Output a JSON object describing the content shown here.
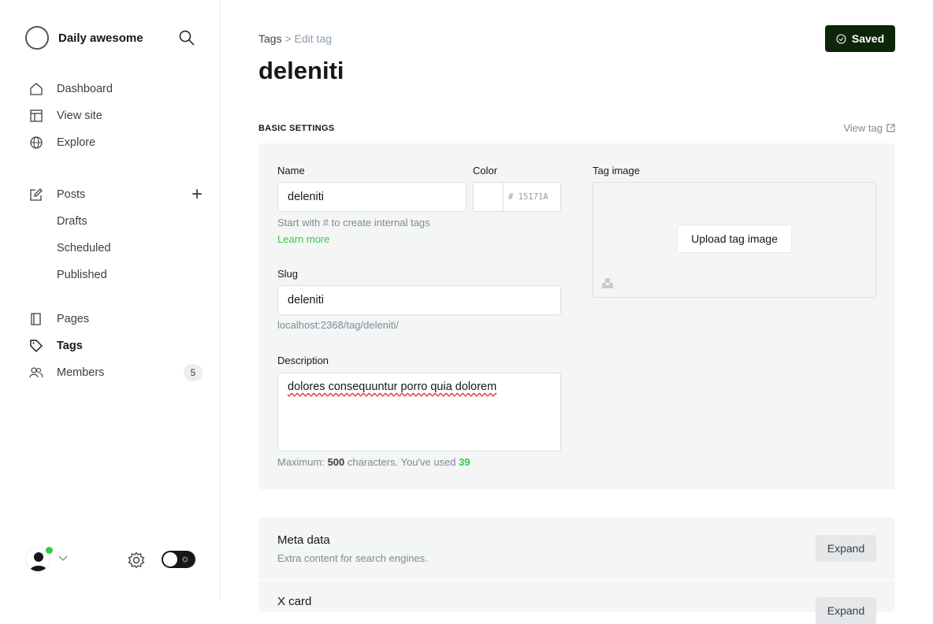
{
  "sidebar": {
    "brand": "Daily awesome",
    "nav": [
      {
        "label": "Dashboard"
      },
      {
        "label": "View site"
      },
      {
        "label": "Explore"
      }
    ],
    "posts": {
      "label": "Posts",
      "sub": [
        "Drafts",
        "Scheduled",
        "Published"
      ]
    },
    "content": [
      {
        "label": "Pages"
      },
      {
        "label": "Tags"
      },
      {
        "label": "Members",
        "badge": "5"
      }
    ]
  },
  "header": {
    "breadcrumb_parent": "Tags",
    "breadcrumb_sep": ">",
    "breadcrumb_current": "Edit tag",
    "title": "deleniti",
    "saved_label": "Saved"
  },
  "basic": {
    "section_title": "BASIC SETTINGS",
    "view_tag": "View tag",
    "name_label": "Name",
    "name_value": "deleniti",
    "name_hint": "Start with # to create internal tags",
    "learn_more": "Learn more",
    "color_label": "Color",
    "color_value": "# 15171A",
    "slug_label": "Slug",
    "slug_value": "deleniti",
    "slug_url": "localhost:2368/tag/deleniti/",
    "desc_label": "Description",
    "desc_value": "dolores consequuntur porro quia dolorem",
    "desc_hint_prefix": "Maximum:",
    "desc_max": "500",
    "desc_hint_mid": "characters. You've used",
    "desc_used": "39",
    "image_label": "Tag image",
    "upload_label": "Upload tag image"
  },
  "cards": [
    {
      "title": "Meta data",
      "subtitle": "Extra content for search engines.",
      "button": "Expand"
    },
    {
      "title": "X card",
      "button": "Expand"
    }
  ]
}
